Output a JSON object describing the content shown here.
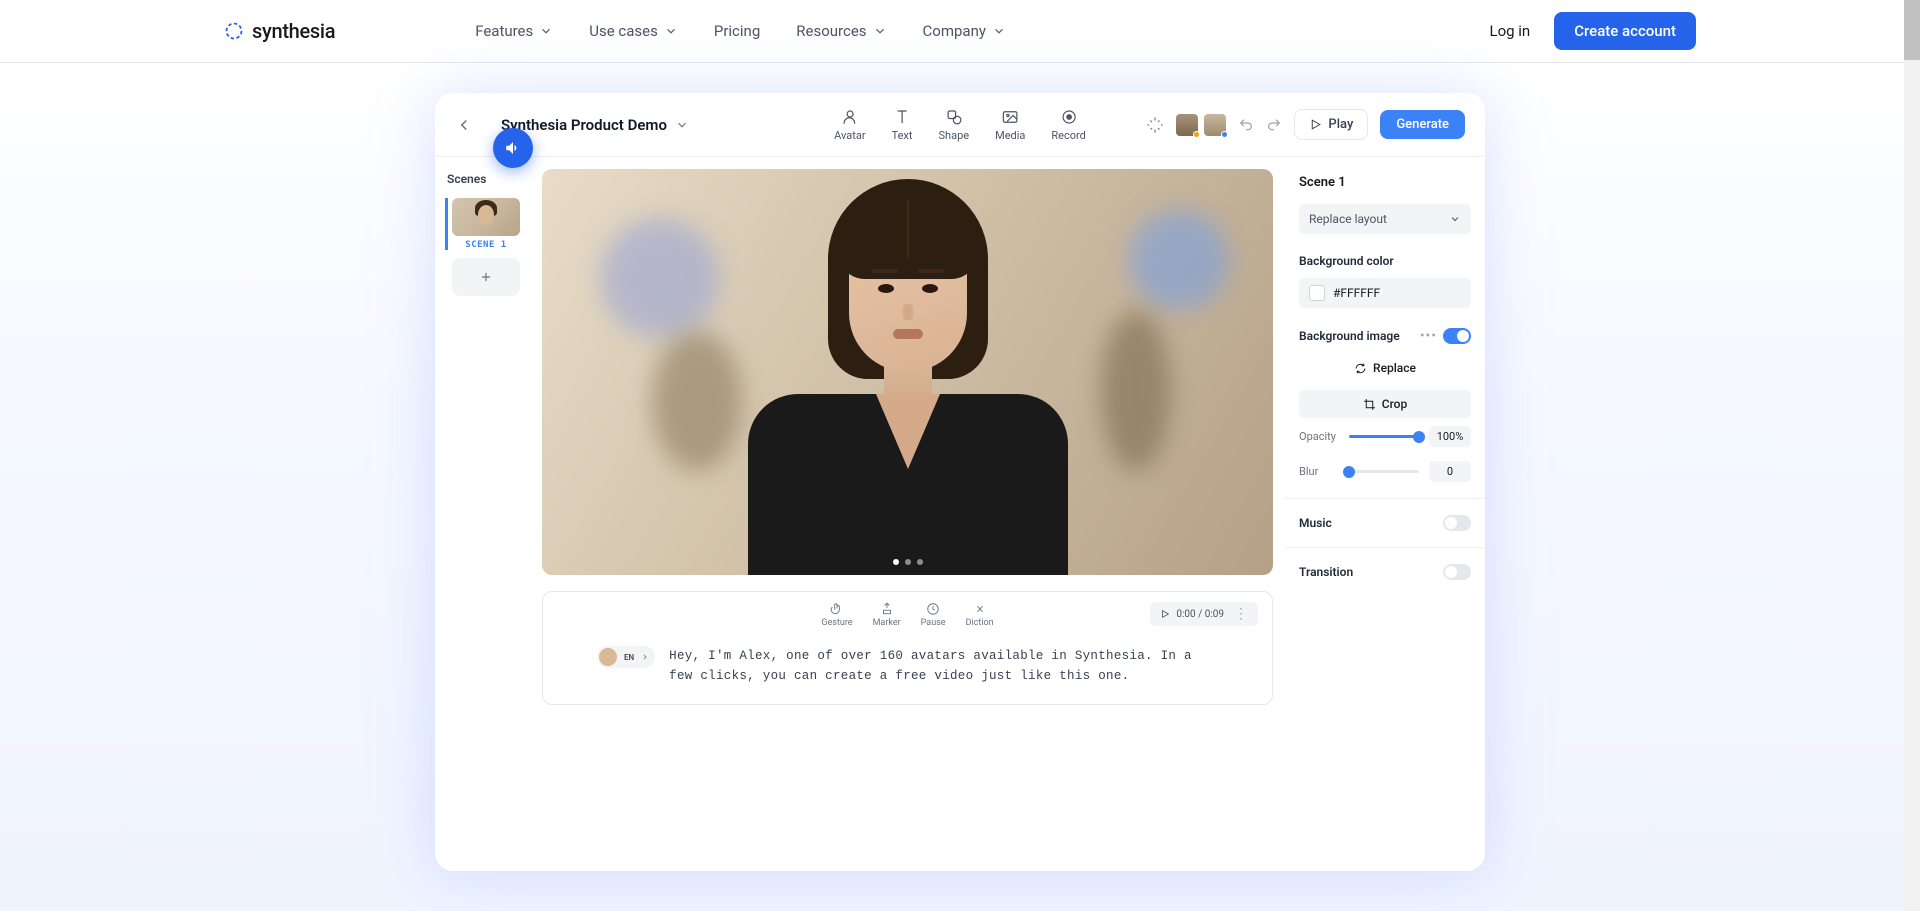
{
  "nav": {
    "brand": "synthesia",
    "links": [
      "Features",
      "Use cases",
      "Pricing",
      "Resources",
      "Company"
    ],
    "login": "Log in",
    "create": "Create account"
  },
  "editor": {
    "project_title": "Synthesia Product Demo",
    "tools": {
      "avatar": "Avatar",
      "text": "Text",
      "shape": "Shape",
      "media": "Media",
      "record": "Record"
    },
    "play": "Play",
    "generate": "Generate",
    "avatars": {
      "dot1": "#f59e0b",
      "dot2": "#3b82f6"
    }
  },
  "scenes": {
    "title": "Scenes",
    "scene1_label": "SCENE 1"
  },
  "script": {
    "tools": {
      "gesture": "Gesture",
      "marker": "Marker",
      "pause": "Pause",
      "diction": "Diction"
    },
    "time": "0:00 / 0:09",
    "lang": "EN",
    "text": "Hey, I'm Alex, one of over 160 avatars available in Synthesia. In a few clicks, you can create a free video just like this one."
  },
  "panel": {
    "title": "Scene 1",
    "layout": "Replace layout",
    "bg_color_label": "Background color",
    "bg_color_value": "#FFFFFF",
    "bg_image_label": "Background image",
    "replace": "Replace",
    "crop": "Crop",
    "opacity_label": "Opacity",
    "opacity_value": "100%",
    "blur_label": "Blur",
    "blur_value": "0",
    "music_label": "Music",
    "transition_label": "Transition"
  }
}
